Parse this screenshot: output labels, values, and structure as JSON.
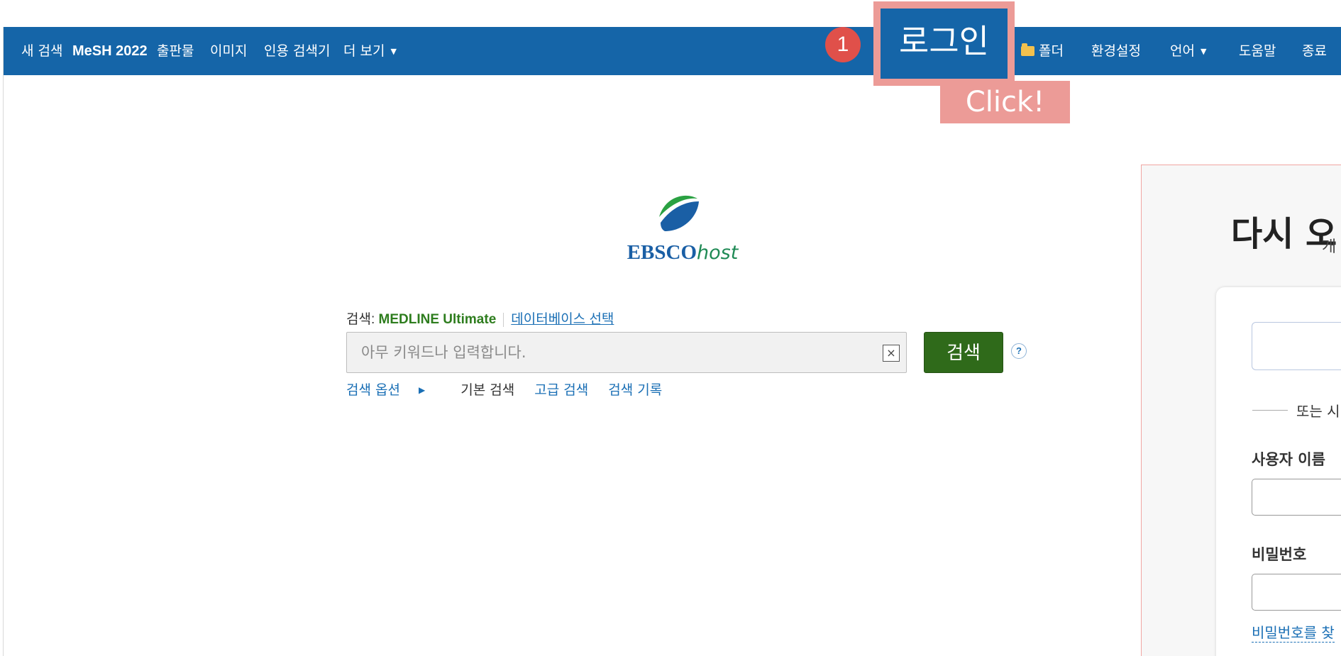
{
  "nav": {
    "new_search": "새 검색",
    "mesh": "MeSH 2022",
    "publications": "출판물",
    "images": "이미지",
    "citation_finder": "인용 검색기",
    "more": "더 보기",
    "login": "로그인",
    "folder": "폴더",
    "preferences": "환경설정",
    "language": "언어",
    "help": "도움말",
    "exit": "종료"
  },
  "annotation": {
    "step_number": "1",
    "click_label": "Click!"
  },
  "logo": {
    "ebsco": "EBSCO",
    "host": "host"
  },
  "search": {
    "searching_label": "검색:",
    "database": "MEDLINE Ultimate",
    "choose_databases": "데이터베이스 선택",
    "placeholder": "아무 키워드나 입력합니다.",
    "clear_symbol": "×",
    "button_label": "검색",
    "help_symbol": "?",
    "options": "검색 옵션",
    "basic": "기본 검색",
    "advanced": "고급 검색",
    "history": "검색 기록"
  },
  "login_panel": {
    "title": "다시 오",
    "subtitle": "개",
    "or_text": "또는 시",
    "username_label": "사용자 이름",
    "password_label": "비밀번호",
    "forgot_password": "비밀번호를 찾"
  },
  "colors": {
    "nav_bg": "#1565a8",
    "annotation": "#ec9b97",
    "badge": "#e0504a",
    "search_button": "#2f6a1a",
    "database_text": "#2e7d1e",
    "link": "#1a6fb5"
  },
  "icons": {
    "folder": "folder-icon",
    "caret": "caret-down-icon",
    "clear": "clear-icon",
    "help": "help-icon",
    "triangle": "triangle-right-icon"
  }
}
